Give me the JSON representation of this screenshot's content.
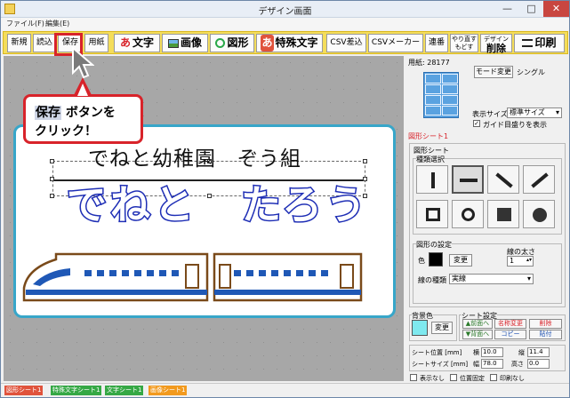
{
  "window": {
    "title": "デザイン画面",
    "minimize": "—",
    "maximize": "□",
    "close": "✕"
  },
  "menu": [
    {
      "label": "ファイル(F)"
    },
    {
      "label": "編集(E)"
    }
  ],
  "toolbar": {
    "new_label": "新規",
    "read_label": "読込",
    "save_label": "保存",
    "paper_label": "用紙",
    "text_label": "文字",
    "text_icon": "あ",
    "image_label": "画像",
    "shape_label": "図形",
    "special_text_label": "特殊文字",
    "special_text_icon": "あ",
    "csv_insert_label": "CSV差込",
    "csv_maker_label": "CSVメーカー",
    "serial_label": "連番",
    "undo_label": "やり直す",
    "redo_label": "もどす",
    "design_label": "デザイン",
    "delete_label": "削除",
    "print_label": "印刷"
  },
  "callout": {
    "highlight": "保存",
    "line1_rest": " ボタンを",
    "line2": "クリック！"
  },
  "canvas": {
    "text1": "でねと幼稚園　ぞう組",
    "text2": "でねと　たろう"
  },
  "panel": {
    "paper_id": "用紙: 28177",
    "mode_change": "モード変更",
    "mode_value": "シングル",
    "display_size_label": "表示サイズ",
    "display_size_value": "標準サイズ",
    "guide_label": "ガイド目盛りを表示",
    "guide_check": "✓",
    "sheet_name": "図形シート1",
    "shape_sheet_title": "図形シート",
    "shape_type_title": "種類選択",
    "shape_settings_title": "図形の設定",
    "color_label": "色",
    "color_change": "変更",
    "line_width_label": "線の太さ",
    "line_width_value": "1",
    "line_type_label": "線の種類",
    "line_type_value": "実線",
    "bg_color_title": "背景色",
    "bg_change": "変更",
    "sheet_settings_title": "シート設定",
    "to_front": "▲前面へ",
    "to_back": "▼背面へ",
    "rename": "名称変更",
    "copy": "コピー",
    "delete": "削除",
    "paste": "貼付",
    "pos_label": "シート位置 [mm]",
    "size_label": "シートサイズ [mm]",
    "x_label": "横",
    "y_label": "縦",
    "width_label": "幅",
    "height_label": "高さ",
    "x_value": "10.0",
    "y_value": "11.4",
    "width_value": "78.0",
    "height_value": "0.0",
    "hide_label": "表示なし",
    "lock_label": "位置固定",
    "noprint_label": "印刷なし"
  },
  "status_tags": [
    {
      "label": "図形シート1",
      "color": "#e0533c"
    },
    {
      "label": "特殊文字シート1",
      "color": "#35a845"
    },
    {
      "label": "文字シート1",
      "color": "#35a845"
    },
    {
      "label": "画像シート1",
      "color": "#f29a1e"
    }
  ],
  "colors": {
    "accent_red": "#d8232a",
    "card_border": "#37a6c9",
    "toolbar_yellow": "#f4dd5a",
    "name_blue": "#1e2eb5",
    "bg_color_swatch": "#7fe9ef"
  }
}
